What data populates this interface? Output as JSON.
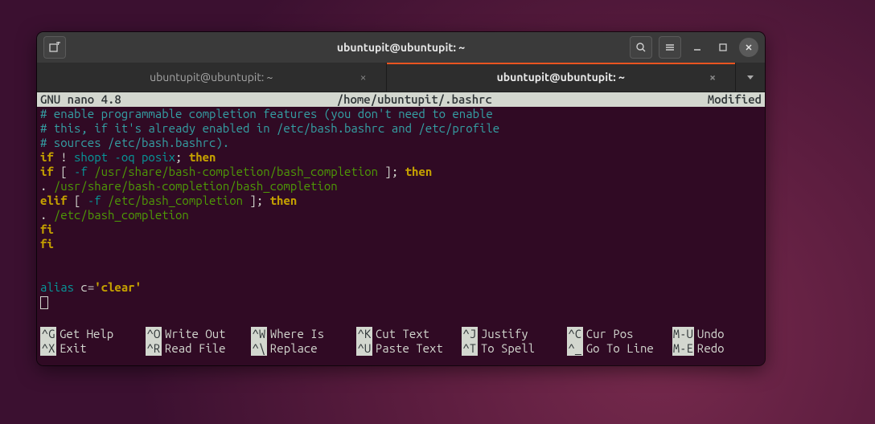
{
  "window": {
    "title": "ubuntupit@ubuntupit: ~"
  },
  "tabs": {
    "inactive_label": "ubuntupit@ubuntupit: ~",
    "active_label": "ubuntupit@ubuntupit: ~"
  },
  "nano": {
    "app": "GNU  nano  4.8",
    "filepath": "/home/ubuntupit/.bashrc",
    "state": "Modified",
    "comment1": "# enable programmable completion features (you don't need to enable",
    "comment2": "# this, if it's already enabled in /etc/bash.bashrc and /etc/profile",
    "comment3": "# sources /etc/bash.bashrc).",
    "l_if": "if",
    "l_bang": " ! ",
    "l_shopt": "shopt -oq posix",
    "l_semi_then": "; ",
    "l_then": "then",
    "l2_if": "  if",
    "l2_brack": " [ ",
    "l2_f": "-f ",
    "l2_path": "/usr/share/bash-completion/bash_completion",
    "l2_close": " ]; ",
    "l3_dot": "    . ",
    "l3_path": "/usr/share/bash-completion/bash_completion",
    "l4_elif": "  elif",
    "l4_brack": " [ ",
    "l4_f": "-f ",
    "l4_path": "/etc/bash_completion",
    "l4_close": " ]; ",
    "l5_dot": "    . ",
    "l5_path": "/etc/bash_completion",
    "l6_fi": "  fi",
    "l7_fi": "fi",
    "alias_kw": "alias",
    "alias_name": " c",
    "alias_eq": "=",
    "alias_val": "'clear'"
  },
  "shortcuts": {
    "r1": [
      {
        "k": "^G",
        "l": "Get Help"
      },
      {
        "k": "^O",
        "l": "Write Out"
      },
      {
        "k": "^W",
        "l": "Where Is"
      },
      {
        "k": "^K",
        "l": "Cut Text"
      },
      {
        "k": "^J",
        "l": "Justify"
      },
      {
        "k": "^C",
        "l": "Cur Pos"
      },
      {
        "k": "M-U",
        "l": "Undo"
      }
    ],
    "r2": [
      {
        "k": "^X",
        "l": "Exit"
      },
      {
        "k": "^R",
        "l": "Read File"
      },
      {
        "k": "^\\",
        "l": "Replace"
      },
      {
        "k": "^U",
        "l": "Paste Text"
      },
      {
        "k": "^T",
        "l": "To Spell"
      },
      {
        "k": "^_",
        "l": "Go To Line"
      },
      {
        "k": "M-E",
        "l": "Redo"
      }
    ]
  }
}
